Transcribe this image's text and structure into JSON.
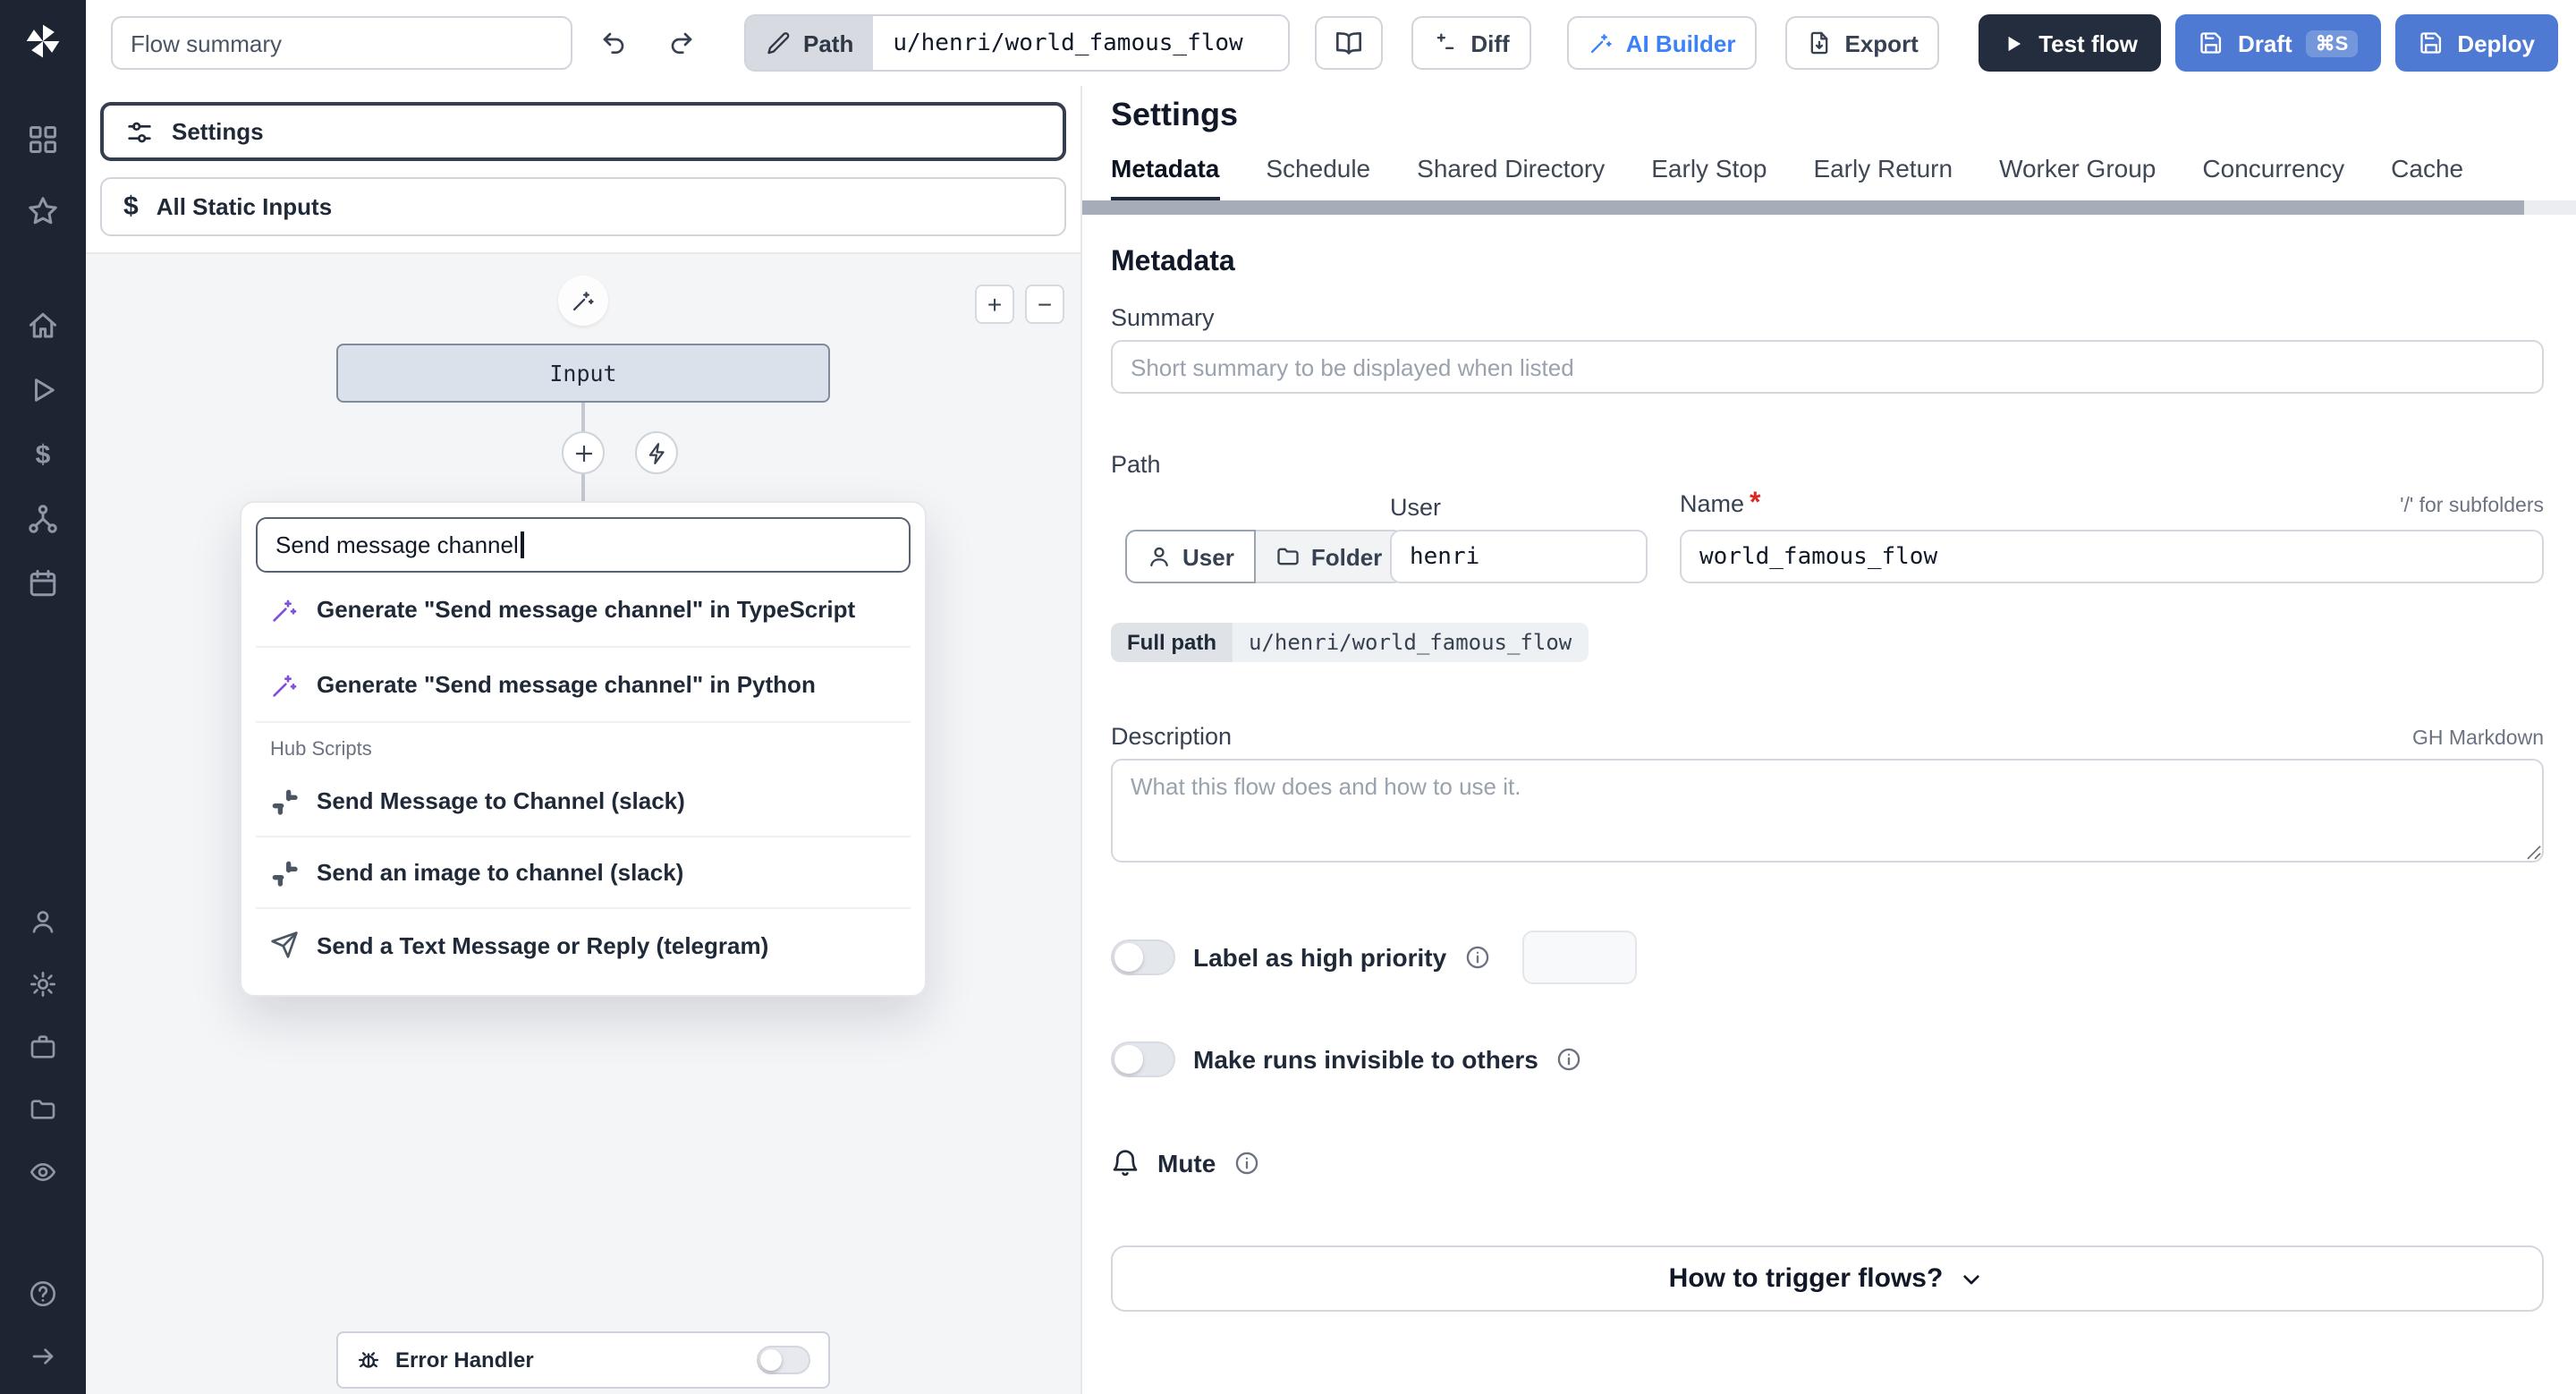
{
  "colors": {
    "sidebar_background": "#1e2532",
    "primary_button_blue": "#4e7ad3",
    "ai_accent_blue": "#3b82f6",
    "required_asterisk_red": "#dc2626"
  },
  "icons": {
    "dollar": "$",
    "zoom_in": "+",
    "zoom_out": "−"
  },
  "topbar": {
    "flow_summary_placeholder": "Flow summary",
    "path_button_label": "Path",
    "path_value": "u/henri/world_famous_flow",
    "diff_label": "Diff",
    "ai_builder_label": "AI Builder",
    "export_label": "Export",
    "test_flow_label": "Test flow",
    "draft_label": "Draft",
    "draft_shortcut": "⌘S",
    "deploy_label": "Deploy"
  },
  "flow_editor": {
    "settings_button_label": "Settings",
    "static_inputs_label": "All Static Inputs",
    "input_node_label": "Input",
    "error_handler_label": "Error Handler",
    "search_value": "Send message channel",
    "generate_items": [
      "Generate \"Send message channel\" in TypeScript",
      "Generate \"Send message channel\" in Python"
    ],
    "hub_section_label": "Hub Scripts",
    "hub_items": [
      "Send Message to Channel (slack)",
      "Send an image to channel (slack)",
      "Send a Text Message or Reply (telegram)"
    ]
  },
  "settings_panel": {
    "title": "Settings",
    "tabs": [
      "Metadata",
      "Schedule",
      "Shared Directory",
      "Early Stop",
      "Early Return",
      "Worker Group",
      "Concurrency",
      "Cache"
    ],
    "heading": "Metadata",
    "summary_label": "Summary",
    "summary_placeholder": "Short summary to be displayed when listed",
    "path_section_label": "Path",
    "owner_toggle_user": "User",
    "owner_toggle_folder": "Folder",
    "user_field_label": "User",
    "user_value": "henri",
    "name_label": "Name",
    "required_marker": "*",
    "subfolder_hint": "'/' for subfolders",
    "name_value": "world_famous_flow",
    "full_path_label": "Full path",
    "full_path_value": "u/henri/world_famous_flow",
    "description_label": "Description",
    "markdown_hint": "GH Markdown",
    "description_placeholder": "What this flow does and how to use it.",
    "high_priority_label": "Label as high priority",
    "invisible_runs_label": "Make runs invisible to others",
    "mute_label": "Mute",
    "trigger_question": "How to trigger flows?"
  }
}
